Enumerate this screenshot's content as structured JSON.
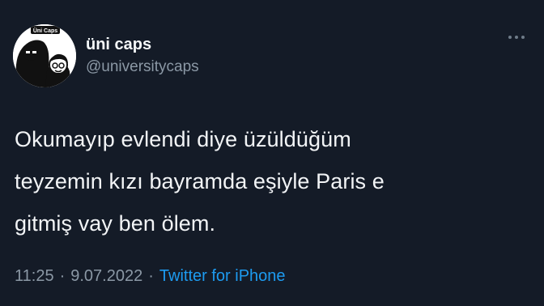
{
  "user": {
    "display_name": "üni caps",
    "handle": "@universitycaps",
    "avatar_label": "Üni Caps"
  },
  "tweet": {
    "text_lines": [
      "Okumayıp evlendi diye üzüldüğüm",
      "teyzemin kızı bayramda eşiyle Paris e",
      "gitmiş vay ben ölem."
    ]
  },
  "meta": {
    "time": "11:25",
    "separator": "·",
    "date": "9.07.2022",
    "source": "Twitter for iPhone"
  },
  "colors": {
    "background": "#141b27",
    "link": "#1d9bf0",
    "secondary_text": "#8b98a5"
  },
  "icons": {
    "more": "more-options-icon"
  }
}
